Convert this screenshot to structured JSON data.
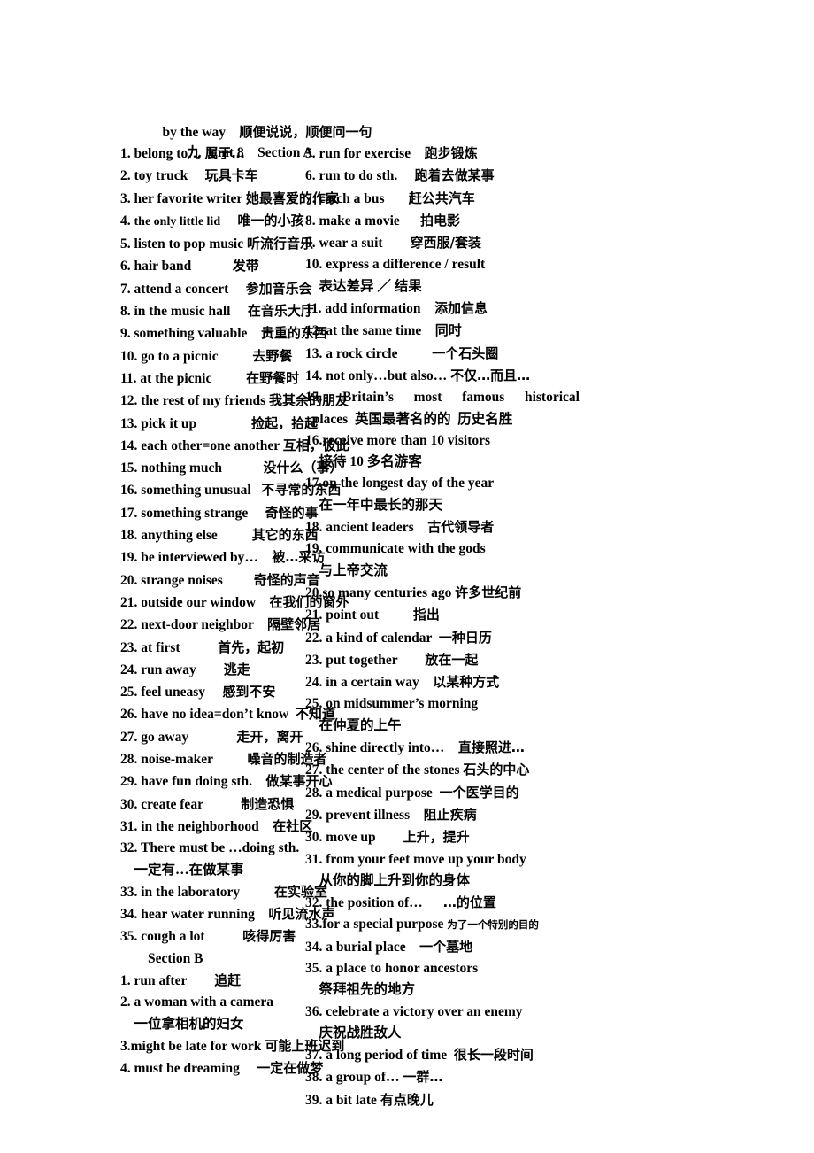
{
  "document": {
    "top_note": {
      "en": "by the way",
      "zh": "顺便说说，顺便问一句"
    },
    "title": "九  Unit 8    Section A"
  },
  "left_column": {
    "section_a_items": [
      {
        "num": "1.",
        "en": "belong to…",
        "zh": "属于…",
        "gap": " "
      },
      {
        "num": "2.",
        "en": "toy truck",
        "zh": "玩具卡车",
        "gap": "     "
      },
      {
        "num": "3.",
        "en": "her favorite writer",
        "zh": "她最喜爱的作家",
        "gap": " "
      },
      {
        "num": "4.",
        "en": "the only little lid",
        "zh": "唯一的小孩",
        "gap": "     ",
        "small_en": true
      },
      {
        "num": "5.",
        "en": "listen to pop music",
        "zh": "听流行音乐",
        "gap": " "
      },
      {
        "num": "6.",
        "en": "hair band",
        "zh": "发带",
        "gap": "            "
      },
      {
        "num": "7.",
        "en": "attend a concert",
        "zh": "参加音乐会",
        "gap": "     "
      },
      {
        "num": "8.",
        "en": "in the music hall",
        "zh": "在音乐大厅",
        "gap": "     "
      },
      {
        "num": "9.",
        "en": "something valuable",
        "zh": "贵重的东西",
        "gap": "    "
      },
      {
        "num": "10.",
        "en": "go to a picnic",
        "zh": "去野餐",
        "gap": "          "
      },
      {
        "num": "11.",
        "en": "at the picnic",
        "zh": "在野餐时",
        "gap": "          "
      },
      {
        "num": "12.",
        "en": "the rest of my friends",
        "zh": "我其余的朋友",
        "gap": " "
      },
      {
        "num": "13.",
        "en": "pick it up",
        "zh": "捡起，拾起",
        "gap": "                "
      },
      {
        "num": "14.",
        "en": "each other=one another",
        "zh": "互相，彼此",
        "gap": " "
      },
      {
        "num": "15.",
        "en": "nothing much",
        "zh": "没什么（事）",
        "gap": "            "
      },
      {
        "num": "16.",
        "en": "something unusual",
        "zh": "不寻常的东西",
        "gap": "   "
      },
      {
        "num": "17.",
        "en": "something strange",
        "zh": "奇怪的事",
        "gap": "     "
      },
      {
        "num": "18.",
        "en": "anything else",
        "zh": "其它的东西",
        "gap": "          "
      },
      {
        "num": "19.",
        "en": "be interviewed by…",
        "zh": "被…采访",
        "gap": "    "
      },
      {
        "num": "20.",
        "en": "strange noises",
        "zh": "奇怪的声音",
        "gap": "         "
      },
      {
        "num": "21.",
        "en": "outside our window",
        "zh": "在我们的窗外",
        "gap": "    "
      },
      {
        "num": "22.",
        "en": "next-door neighbor",
        "zh": "隔壁邻居",
        "gap": "    "
      },
      {
        "num": "23.",
        "en": "at first",
        "zh": "首先，起初",
        "gap": "           "
      },
      {
        "num": "24.",
        "en": "run away",
        "zh": "逃走",
        "gap": "        "
      },
      {
        "num": "25.",
        "en": "feel uneasy",
        "zh": "感到不安",
        "gap": "     "
      },
      {
        "num": "26.",
        "en": "have no idea=don’t know",
        "zh": "不知道",
        "gap": "  "
      },
      {
        "num": "27.",
        "en": "go away",
        "zh": "走开，离开",
        "gap": "              "
      },
      {
        "num": "28.",
        "en": "noise-maker",
        "zh": "噪音的制造者",
        "gap": "          "
      },
      {
        "num": "29.",
        "en": "have fun doing sth.",
        "zh": "做某事开心",
        "gap": "    "
      },
      {
        "num": "30.",
        "en": "create fear",
        "zh": "制造恐惧",
        "gap": "           "
      },
      {
        "num": "31.",
        "en": "in the neighborhood",
        "zh": "在社区",
        "gap": "    "
      },
      {
        "num": "32.",
        "en": "There must be …doing sth.",
        "zh": "",
        "gap": "",
        "wrap_zh": "一定有…在做某事"
      },
      {
        "num": "33.",
        "en": "in the laboratory",
        "zh": "在实验室",
        "gap": "          "
      },
      {
        "num": "34.",
        "en": "hear water running",
        "zh": "听见流水声",
        "gap": "    "
      },
      {
        "num": "35.",
        "en": "cough a lot",
        "zh": "咳得厉害",
        "gap": "           "
      }
    ],
    "section_b_title": "Section B",
    "section_b_items": [
      {
        "num": "1.",
        "en": "run after",
        "zh": "追赶",
        "gap": "        "
      },
      {
        "num": "2.",
        "en": "a woman with a camera",
        "zh": "",
        "gap": "",
        "wrap_zh": "一位拿相机的妇女"
      },
      {
        "num": "3.",
        "en": "might be late for work",
        "zh": "可能上班迟到",
        "gap": " ",
        "tight_num": true
      },
      {
        "num": "4.",
        "en": "must be dreaming",
        "zh": "一定在做梦",
        "gap": "     "
      }
    ]
  },
  "right_column": {
    "items": [
      {
        "num": "5.",
        "en": "run for exercise",
        "zh": "跑步锻炼",
        "gap": "    "
      },
      {
        "num": "6.",
        "en": "run to do sth.",
        "zh": "跑着去做某事",
        "gap": "     "
      },
      {
        "num": "7.",
        "en": "catch a bus",
        "zh": "赶公共汽车",
        "gap": "       "
      },
      {
        "num": "8.",
        "en": "make a movie",
        "zh": "拍电影",
        "gap": "      "
      },
      {
        "num": "9.",
        "en": "wear a suit",
        "zh": "穿西服/套装",
        "gap": "        "
      },
      {
        "num": "10.",
        "en": "express a difference / result",
        "zh": "",
        "gap": "",
        "wrap_zh": "表达差异 ／ 结果"
      },
      {
        "num": "11.",
        "en": "add information",
        "zh": "添加信息",
        "gap": "    "
      },
      {
        "num": "12.",
        "en": "at the same time",
        "zh": "同时",
        "gap": "    "
      },
      {
        "num": "13.",
        "en": "a rock circle",
        "zh": "一个石头圈",
        "gap": "          "
      },
      {
        "num": "14.",
        "en": "not only…but also…",
        "zh": "不仅…而且…",
        "gap": ""
      },
      {
        "num": "15.",
        "en": "",
        "zh": "",
        "gap": "",
        "justified_words": [
          "Britain’s",
          "most",
          "famous",
          "historical"
        ],
        "wrap_en": "places",
        "wrap_zh": "英国最著名的的  历史名胜"
      },
      {
        "num": "16.",
        "en": "receive more than 10 visitors",
        "zh": "",
        "gap": "",
        "tight_num": true,
        "wrap_zh": "接待 10 多名游客"
      },
      {
        "num": "17.",
        "en": "on the longest day of the year",
        "zh": "",
        "gap": "",
        "tight_num": true,
        "wrap_zh": "在一年中最长的那天"
      },
      {
        "num": "18.",
        "en": "ancient leaders",
        "zh": "古代领导者",
        "gap": "    "
      },
      {
        "num": "19.",
        "en": "communicate with the gods",
        "zh": "",
        "gap": "",
        "wrap_zh": "与上帝交流"
      },
      {
        "num": "20.",
        "en": "so many centuries ago",
        "zh": "许多世纪前",
        "gap": " ",
        "tight_num": true
      },
      {
        "num": "21.",
        "en": "point out",
        "zh": "指出",
        "gap": "          "
      },
      {
        "num": "22.",
        "en": "a kind of calendar",
        "zh": "一种日历",
        "gap": "  "
      },
      {
        "num": "23.",
        "en": "put together",
        "zh": "放在一起",
        "gap": "        "
      },
      {
        "num": "24.",
        "en": "in a certain way",
        "zh": "以某种方式",
        "gap": "    "
      },
      {
        "num": "25.",
        "en": "on midsummer’s morning",
        "zh": "",
        "gap": "",
        "wrap_zh": "在仲夏的上午"
      },
      {
        "num": "26.",
        "en": "shine directly into…",
        "zh": "直接照进…",
        "gap": "    "
      },
      {
        "num": "27.",
        "en": "the center of the stones",
        "zh": "石头的中心",
        "gap": " "
      },
      {
        "num": "28.",
        "en": "a medical purpose",
        "zh": "一个医学目的",
        "gap": "  "
      },
      {
        "num": "29.",
        "en": "prevent illness",
        "zh": "阻止疾病",
        "gap": "    "
      },
      {
        "num": "30.",
        "en": "move up",
        "zh": "上升，提升",
        "gap": "        "
      },
      {
        "num": "31.",
        "en": "from your feet move up your body",
        "zh": "",
        "gap": "",
        "wrap_zh": "从你的脚上升到你的身体"
      },
      {
        "num": "32.",
        "en": "the position of…",
        "zh": "…的位置",
        "gap": "      "
      },
      {
        "num": "33.",
        "en": "for a special purpose",
        "zh": "为了一个特别的目的",
        "gap": " ",
        "tight_num": true,
        "tiny_zh": true
      },
      {
        "num": "34.",
        "en": "a burial place",
        "zh": "一个墓地",
        "gap": "    "
      },
      {
        "num": "35.",
        "en": "a place to honor ancestors",
        "zh": "",
        "gap": "",
        "wrap_zh": "祭拜祖先的地方"
      },
      {
        "num": "36.",
        "en": "celebrate a victory over an enemy",
        "zh": "",
        "gap": "",
        "wrap_zh": "庆祝战胜敌人"
      },
      {
        "num": "37.",
        "en": "a long period of time",
        "zh": "很长一段时间",
        "gap": "  "
      },
      {
        "num": "38.",
        "en": "a group of…",
        "zh": "一群…",
        "gap": " "
      },
      {
        "num": "39.",
        "en": "a bit late",
        "zh": "有点晚儿",
        "gap": " "
      }
    ]
  }
}
